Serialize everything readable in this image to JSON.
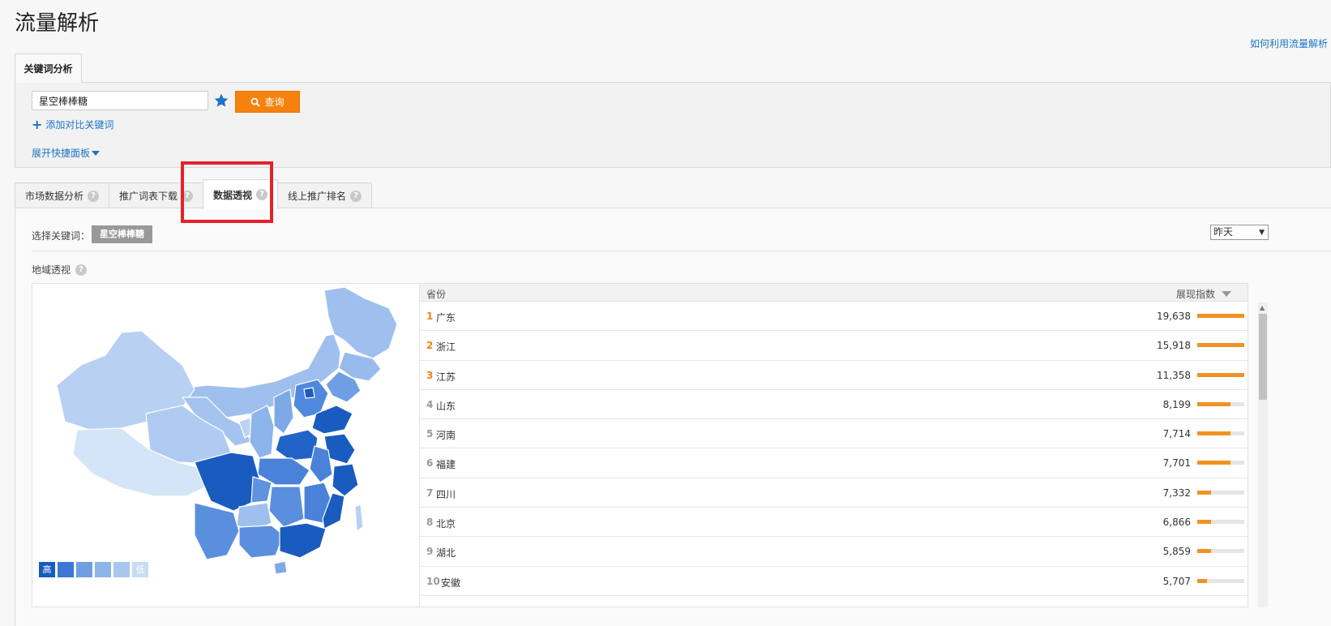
{
  "page": {
    "title": "流量解析",
    "help_link": "如何利用流量解析"
  },
  "top_tab": {
    "label": "关键词分析"
  },
  "search": {
    "keyword": "星空棒棒糖",
    "query_label": "查询",
    "add_compare": "添加对比关键词",
    "expand_panel": "展开快捷面板"
  },
  "tabs": [
    {
      "label": "市场数据分析"
    },
    {
      "label": "推广词表下载"
    },
    {
      "label": "数据透视"
    },
    {
      "label": "线上推广排名"
    }
  ],
  "filter": {
    "select_label": "选择关键词：",
    "chip": "星空棒棒糖",
    "date": "昨天"
  },
  "region": {
    "title": "地域透视",
    "legend_high": "高",
    "legend_low": "低"
  },
  "colors": {
    "accent": "#f5820e",
    "link": "#1e73c6",
    "highlight": "#e8202a",
    "map_dark": "#1a5bbf",
    "map_light": "#d5e5f8"
  },
  "table": {
    "col_province": "省份",
    "col_index": "展现指数",
    "rows": [
      {
        "rank": "1",
        "province": "广东",
        "value": "19,638",
        "bar": 100
      },
      {
        "rank": "2",
        "province": "浙江",
        "value": "15,918",
        "bar": 100
      },
      {
        "rank": "3",
        "province": "江苏",
        "value": "11,358",
        "bar": 100
      },
      {
        "rank": "4",
        "province": "山东",
        "value": "8,199",
        "bar": 70
      },
      {
        "rank": "5",
        "province": "河南",
        "value": "7,714",
        "bar": 70
      },
      {
        "rank": "6",
        "province": "福建",
        "value": "7,701",
        "bar": 70
      },
      {
        "rank": "7",
        "province": "四川",
        "value": "7,332",
        "bar": 30
      },
      {
        "rank": "8",
        "province": "北京",
        "value": "6,866",
        "bar": 30
      },
      {
        "rank": "9",
        "province": "湖北",
        "value": "5,859",
        "bar": 30
      },
      {
        "rank": "10",
        "province": "安徽",
        "value": "5,707",
        "bar": 20
      }
    ]
  }
}
